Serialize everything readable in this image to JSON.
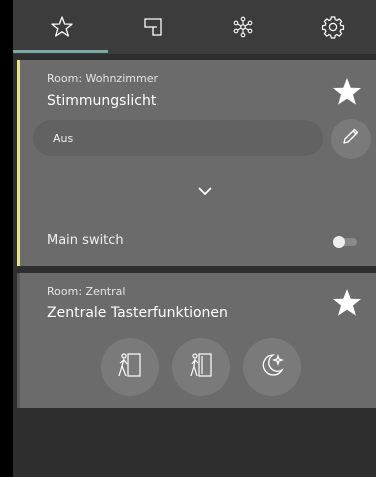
{
  "nav": {
    "tabs": [
      {
        "name": "favorites",
        "icon": "star-outline-icon",
        "active": true
      },
      {
        "name": "rooms",
        "icon": "floorplan-icon",
        "active": false
      },
      {
        "name": "functions",
        "icon": "network-icon",
        "active": false
      },
      {
        "name": "settings",
        "icon": "gear-icon",
        "active": false
      }
    ]
  },
  "cards": [
    {
      "room": "Room: Wohnzimmer",
      "title": "Stimmungslicht",
      "accent_color": "#e8e28a",
      "favorite": true,
      "scene_value": "Aus",
      "main_switch": {
        "label": "Main switch",
        "on": false
      }
    },
    {
      "room": "Room: Zentral",
      "title": "Zentrale Tasterfunktionen",
      "accent_color": "#5a5a5a",
      "favorite": true,
      "buttons": [
        {
          "icon": "leave-home-icon"
        },
        {
          "icon": "come-home-icon"
        },
        {
          "icon": "night-mode-icon"
        }
      ]
    }
  ],
  "colors": {
    "background": "#2e2e2e",
    "topbar": "#3c3c3c",
    "card": "#6b6b6b",
    "active_tab_indicator": "#7fa6a6"
  }
}
